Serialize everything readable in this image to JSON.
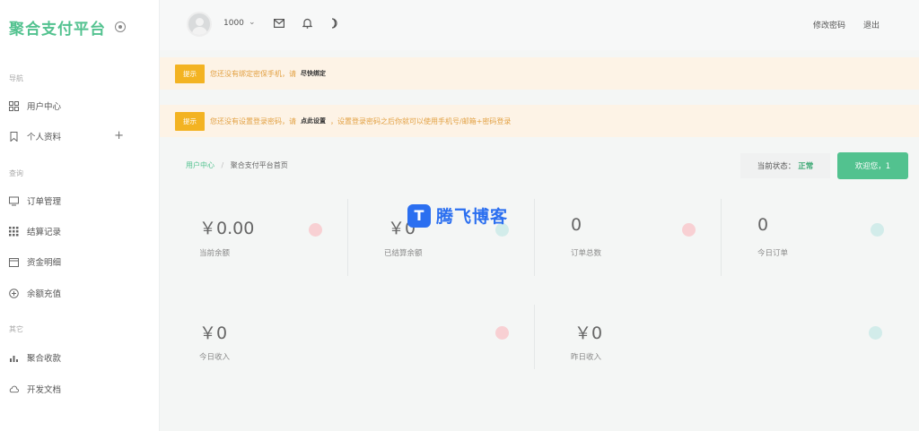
{
  "sidebar": {
    "brand": "聚合支付平台",
    "groups": [
      {
        "title": "导航",
        "items": [
          {
            "label": "用户中心"
          },
          {
            "label": "个人资料"
          }
        ]
      },
      {
        "title": "查询",
        "items": [
          {
            "label": "订单管理"
          },
          {
            "label": "结算记录"
          },
          {
            "label": "资金明细"
          },
          {
            "label": "余额充值"
          }
        ]
      },
      {
        "title": "其它",
        "items": [
          {
            "label": "聚合收款"
          },
          {
            "label": "开发文档"
          }
        ]
      }
    ]
  },
  "header": {
    "username": "1000",
    "edit_password": "修改密码",
    "logout": "退出"
  },
  "alerts": [
    {
      "tag": "提示",
      "message": "您还没有绑定密保手机，请",
      "action": "尽快绑定",
      "suffix": ""
    },
    {
      "tag": "提示",
      "message": "您还没有设置登录密码，请",
      "action": "点此设置",
      "suffix": "，设置登录密码之后你就可以使用手机号/邮箱+密码登录"
    }
  ],
  "breadcrumb": {
    "current": "用户中心",
    "separator": "/",
    "page": "聚合支付平台首页"
  },
  "status": {
    "label": "当前状态：",
    "value": "正常"
  },
  "welcome": "欢迎您，1",
  "stats_row1": [
    {
      "value": "￥0.00",
      "label": "当前余额"
    },
    {
      "value": "￥0",
      "label": "已结算余额"
    },
    {
      "value": "0",
      "label": "订单总数"
    },
    {
      "value": "0",
      "label": "今日订单"
    }
  ],
  "stats_row2": [
    {
      "value": "￥0",
      "label": "今日收入"
    },
    {
      "value": "￥0",
      "label": "昨日收入"
    }
  ],
  "watermark": {
    "logo_letter": "T",
    "text": "腾飞博客"
  },
  "colors": {
    "brand": "#52c28f",
    "warning": "#f3b322",
    "watermark": "#2b6ff0"
  }
}
